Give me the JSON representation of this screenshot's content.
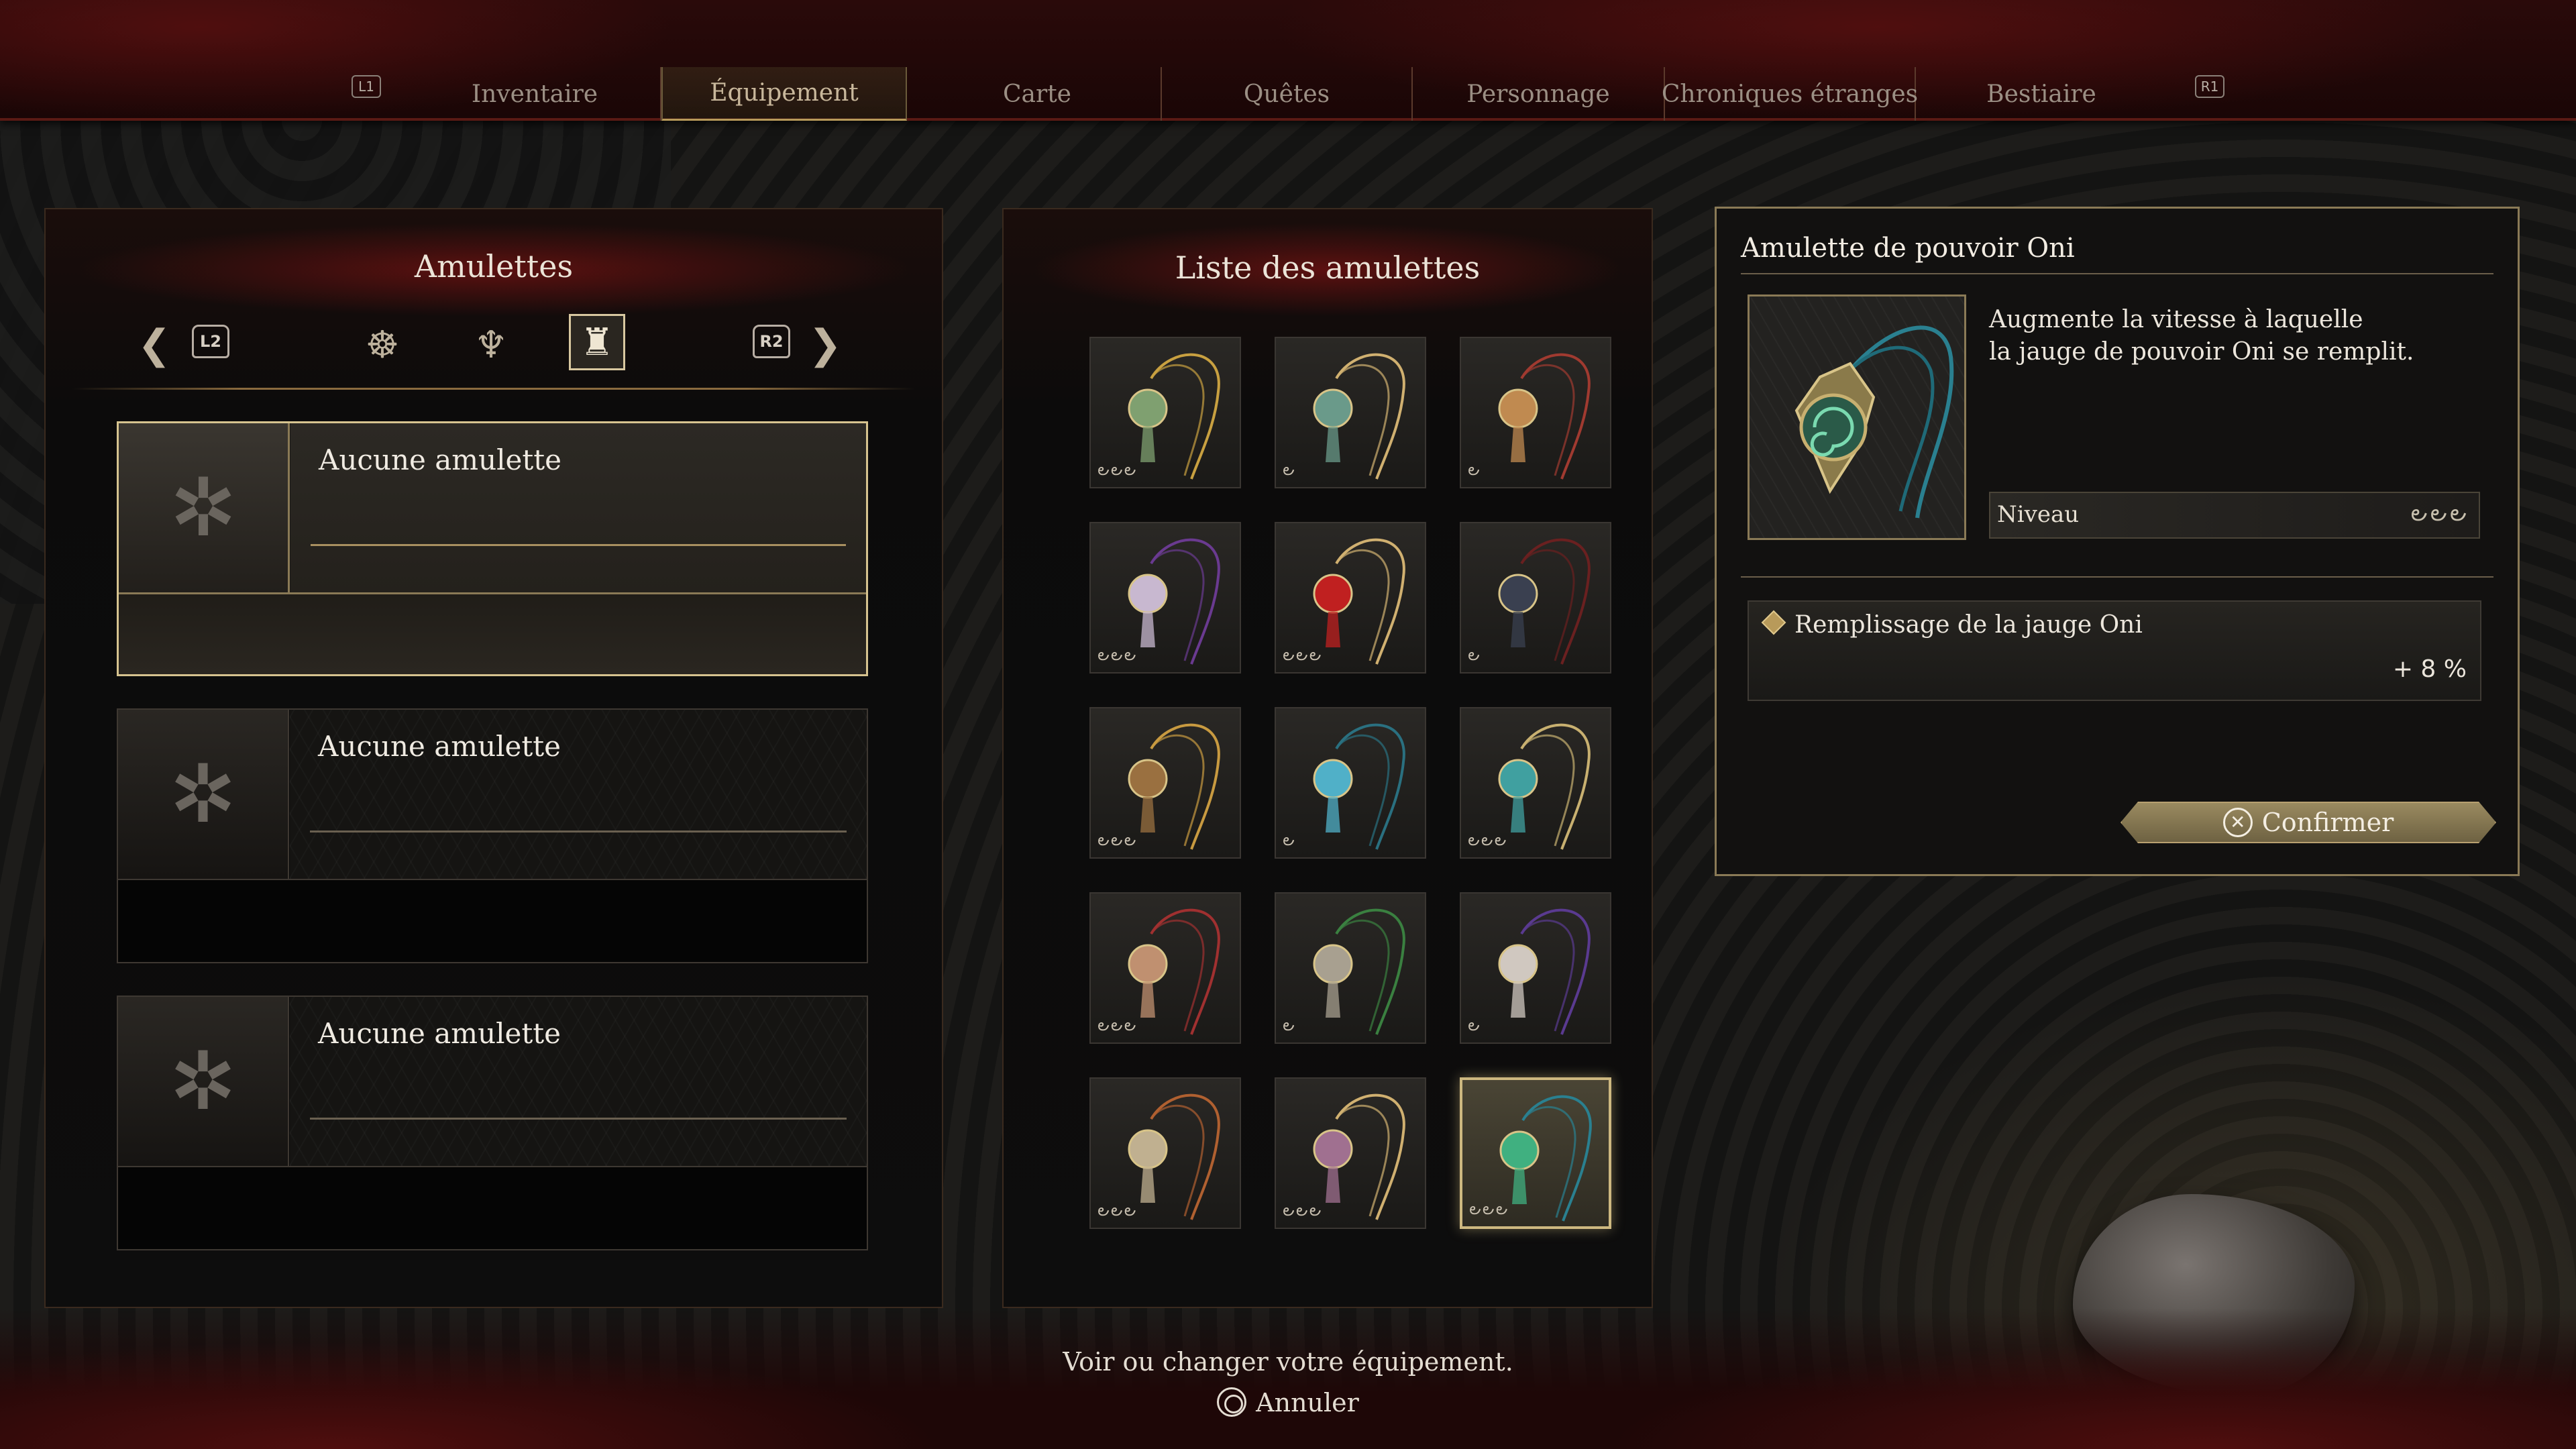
{
  "nav": {
    "left_button": "L1",
    "right_button": "R1",
    "tabs": [
      {
        "label": "Inventaire",
        "active": false
      },
      {
        "label": "Équipement",
        "active": true
      },
      {
        "label": "Carte",
        "active": false
      },
      {
        "label": "Quêtes",
        "active": false
      },
      {
        "label": "Personnage",
        "active": false
      },
      {
        "label": "Chroniques étranges",
        "active": false
      },
      {
        "label": "Bestiaire",
        "active": false
      }
    ]
  },
  "left_panel": {
    "title": "Amulettes",
    "trigger_left": "L2",
    "trigger_right": "R2",
    "slots": [
      {
        "label": "Aucune amulette",
        "selected": true
      },
      {
        "label": "Aucune amulette",
        "selected": false
      },
      {
        "label": "Aucune amulette",
        "selected": false
      }
    ]
  },
  "list_panel": {
    "title": "Liste des amulettes",
    "items": [
      {
        "icon": "amulet-gold-green",
        "level": 3,
        "level_glyphs": "౿౿౿",
        "cord": "#c8a040",
        "gem": "#7fa070"
      },
      {
        "icon": "amulet-blue-pouch",
        "level": 1,
        "level_glyphs": "౿",
        "cord": "#d0b070",
        "gem": "#6a9a8a"
      },
      {
        "icon": "amulet-spiral-red",
        "level": 1,
        "level_glyphs": "౿",
        "cord": "#a03a30",
        "gem": "#c08a50"
      },
      {
        "icon": "amulet-purple-pearl",
        "level": 3,
        "level_glyphs": "౿౿౿",
        "cord": "#6a3a90",
        "gem": "#c8b8d0"
      },
      {
        "icon": "amulet-red-gem",
        "level": 3,
        "level_glyphs": "౿౿౿",
        "cord": "#d0b070",
        "gem": "#c02020"
      },
      {
        "icon": "amulet-dark-crow",
        "level": 1,
        "level_glyphs": "౿",
        "cord": "#6a2020",
        "gem": "#3a4050"
      },
      {
        "icon": "amulet-gold-pouch",
        "level": 3,
        "level_glyphs": "౿౿౿",
        "cord": "#c89a40",
        "gem": "#9a7040"
      },
      {
        "icon": "amulet-teal-feather",
        "level": 1,
        "level_glyphs": "౿",
        "cord": "#2a7080",
        "gem": "#50b0c8"
      },
      {
        "icon": "amulet-teal-bell",
        "level": 3,
        "level_glyphs": "౿౿౿",
        "cord": "#c8b070",
        "gem": "#40a0a0"
      },
      {
        "icon": "amulet-red-fur",
        "level": 3,
        "level_glyphs": "౿౿౿",
        "cord": "#a03030",
        "gem": "#c09070"
      },
      {
        "icon": "amulet-green-fur",
        "level": 1,
        "level_glyphs": "౿",
        "cord": "#3a8040",
        "gem": "#a8a090"
      },
      {
        "icon": "amulet-purple-fur",
        "level": 1,
        "level_glyphs": "౿",
        "cord": "#5a3a90",
        "gem": "#d0c8c0"
      },
      {
        "icon": "amulet-brown-feather",
        "level": 3,
        "level_glyphs": "౿౿౿",
        "cord": "#b06030",
        "gem": "#c0b090"
      },
      {
        "icon": "amulet-violet-tassel",
        "level": 3,
        "level_glyphs": "౿౿౿",
        "cord": "#d0b070",
        "gem": "#a07090"
      },
      {
        "icon": "amulet-oni-power",
        "level": 3,
        "level_glyphs": "౿౿౿",
        "cord": "#2a8090",
        "gem": "#40b080",
        "selected": true
      }
    ]
  },
  "detail": {
    "title": "Amulette de pouvoir Oni",
    "description": "Augmente la vitesse à laquelle\nla jauge de pouvoir Oni se remplit.",
    "level_label": "Niveau",
    "level_glyphs": "౿౿౿",
    "level_value": 3,
    "stat_name": "Remplissage de la jauge Oni",
    "stat_value": "+ 8 %",
    "confirm_label": "Confirmer",
    "confirm_button": "✕"
  },
  "footer": {
    "hint": "Voir ou changer votre équipement.",
    "cancel_label": "Annuler"
  },
  "colors": {
    "accent_gold": "#cdb880",
    "header_red": "#5a1a14"
  }
}
